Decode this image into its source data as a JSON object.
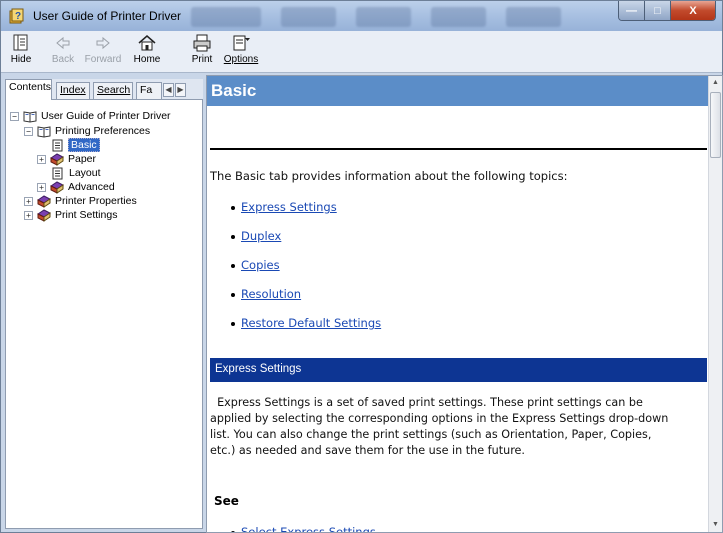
{
  "window": {
    "title": "User Guide of Printer Driver"
  },
  "caption_buttons": {
    "minimize": "—",
    "maximize": "□",
    "close": "X"
  },
  "toolbar": {
    "hide": "Hide",
    "back": "Back",
    "forward": "Forward",
    "home": "Home",
    "print": "Print",
    "options": "Options"
  },
  "tabs": {
    "contents": "Contents",
    "index": "Index",
    "search": "Search",
    "favorites": "Fa"
  },
  "tree": {
    "root": "User Guide of Printer Driver",
    "printing_preferences": "Printing Preferences",
    "basic": "Basic",
    "paper": "Paper",
    "layout": "Layout",
    "advanced": "Advanced",
    "printer_properties": "Printer Properties",
    "print_settings": "Print Settings"
  },
  "topic": {
    "title": "Basic",
    "intro": "The Basic tab provides information about the following topics:",
    "links": [
      "Express Settings",
      "Duplex",
      "Copies",
      "Resolution",
      "Restore Default Settings"
    ],
    "section_title": "Express Settings",
    "section_lines": [
      "  Express Settings is a set of saved print settings. These print settings can be",
      "applied by selecting the corresponding options in the Express Settings drop-down",
      "list. You can also change the print settings (such as Orientation, Paper, Copies,",
      "etc.) as needed and save them for the use in the future."
    ],
    "see_label": "See",
    "see_link": "Select Express Settings"
  },
  "colors": {
    "header": "#5b8dc8",
    "section_bar": "#0d3593",
    "link": "#1a49b4",
    "selection": "#3168c6"
  }
}
